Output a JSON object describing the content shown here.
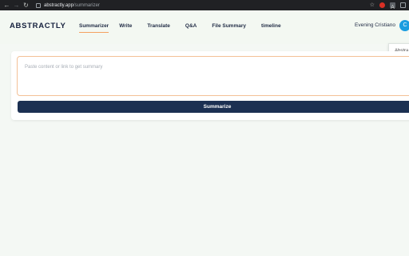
{
  "browser": {
    "url_domain": "abstractly.app",
    "url_path": "/summarizer",
    "back_icon": "arrow-left",
    "forward_icon": "arrow-right",
    "reload_icon": "reload"
  },
  "header": {
    "logo": "ABSTRACTLY",
    "greeting": "Evening Cristiano",
    "avatar_initial": "C",
    "tabs": [
      {
        "label": "Summarizer",
        "active": true
      },
      {
        "label": "Write",
        "active": false
      },
      {
        "label": "Translate",
        "active": false
      },
      {
        "label": "Q&A",
        "active": false
      },
      {
        "label": "File Summary",
        "active": false
      },
      {
        "label": "timeline",
        "active": false
      }
    ]
  },
  "popover": {
    "text": "Abstra"
  },
  "main": {
    "input_placeholder": "Paste content or link to get summary",
    "submit_label": "Summarize"
  },
  "colors": {
    "primary": "#1c3052",
    "accent": "#f4a261",
    "avatar": "#1a9de0"
  }
}
